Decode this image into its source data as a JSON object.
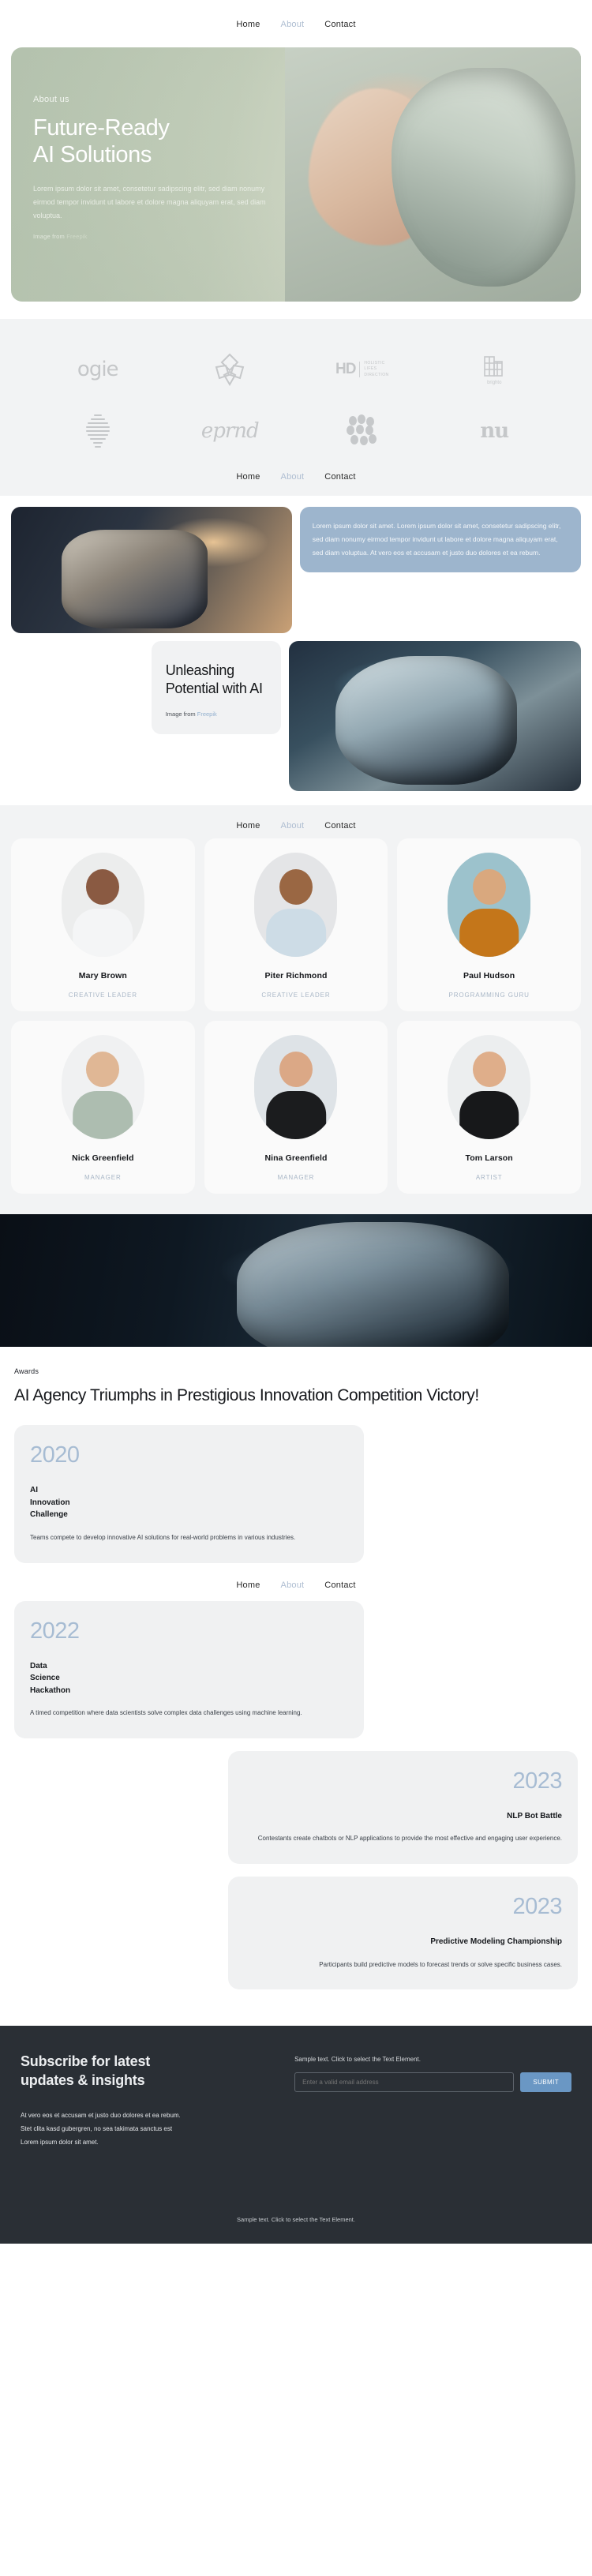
{
  "nav": {
    "items": [
      {
        "label": "Home",
        "state": "active"
      },
      {
        "label": "About",
        "state": "muted"
      },
      {
        "label": "Contact",
        "state": "default"
      }
    ]
  },
  "hero": {
    "eyebrow": "About us",
    "title_line1": "Future-Ready",
    "title_line2": "AI Solutions",
    "paragraph": "Lorem ipsum dolor sit amet, consetetur sadipscing elitr, sed diam nonumy eirmod tempor invidunt ut labore et dolore magna aliquyam erat, sed diam voluptua.",
    "credit_prefix": "Image from ",
    "credit_link": "Freepik",
    "background_color": "#c2cdb9"
  },
  "logos": {
    "items": [
      {
        "name": "ogie",
        "type": "wordmark"
      },
      {
        "name": "flower-mark",
        "type": "symbol"
      },
      {
        "name": "HD",
        "type": "hd",
        "sub_line1": "HOLISTIC",
        "sub_line2": "LIFES",
        "sub_line3": "DIRECTION"
      },
      {
        "name": "brighto",
        "type": "brighto",
        "caption": "brighto"
      },
      {
        "name": "striped-sphere",
        "type": "symbol"
      },
      {
        "name": "eprnd",
        "type": "wordmark"
      },
      {
        "name": "dots-mark",
        "type": "symbol"
      },
      {
        "name": "nu",
        "type": "wordmark"
      }
    ]
  },
  "showcase": {
    "blue_card_text": "Lorem ipsum dolor sit amet. Lorem ipsum dolor sit amet, consetetur sadipscing elitr, sed diam nonumy eirmod tempor invidunt ut labore et dolore magna aliquyam erat, sed diam voluptua. At vero eos et accusam et justo duo dolores et ea rebum.",
    "blue_card_color": "#9db5cd",
    "card_title_line1": "Unleashing",
    "card_title_line2": "Potential with AI",
    "credit_prefix": "Image from ",
    "credit_link": "Freepik",
    "image_left_name": "robot-workshop-photo",
    "image_right_name": "robot-face-photo"
  },
  "team": {
    "members": [
      {
        "name": "Mary Brown",
        "role": "CREATIVE LEADER",
        "bg": "#eceded",
        "skin": "#8a5a42",
        "cloth": "#f4f5f6",
        "hair": "#1d1a18"
      },
      {
        "name": "Piter Richmond",
        "role": "CREATIVE LEADER",
        "bg": "#e4e5e7",
        "skin": "#9a6743",
        "cloth": "#cddce6",
        "hair": "#4a3322"
      },
      {
        "name": "Paul Hudson",
        "role": "PROGRAMMING GURU",
        "bg": "#9cc2cc",
        "skin": "#d9a87e",
        "cloth": "#c4761a",
        "hair": "#3a2b22"
      },
      {
        "name": "Nick Greenfield",
        "role": "MANAGER",
        "bg": "#f0f1f2",
        "skin": "#e0b795",
        "cloth": "#adbdb0",
        "hair": "#6b5743"
      },
      {
        "name": "Nina Greenfield",
        "role": "MANAGER",
        "bg": "#dee3e7",
        "skin": "#dba886",
        "cloth": "#1b1c1e",
        "hair": "#2a2622"
      },
      {
        "name": "Tom Larson",
        "role": "ARTIST",
        "bg": "#eceeef",
        "skin": "#dfae8a",
        "cloth": "#17181a",
        "hair": "#3c2f26"
      }
    ]
  },
  "banner": {
    "image_name": "robot-head-dark-banner"
  },
  "awards": {
    "eyebrow": "Awards",
    "title": "AI Agency Triumphs in Prestigious Innovation Competition Victory!",
    "year_color": "#a7bcd3",
    "items": [
      {
        "year": "2020",
        "name": "AI\nInnovation\nChallenge",
        "description": "Teams compete to develop innovative AI solutions for real-world problems in various industries.",
        "align": "left"
      },
      {
        "year": "2022",
        "name": "Data\nScience\nHackathon",
        "description": "A timed competition where data scientists solve complex data challenges using machine learning.",
        "align": "left"
      },
      {
        "year": "2023",
        "name": "NLP Bot Battle",
        "description": "Contestants create chatbots or NLP applications to provide the most effective and engaging user experience.",
        "align": "right"
      },
      {
        "year": "2023",
        "name": "Predictive Modeling Championship",
        "description": "Participants build predictive models to forecast trends or solve specific business cases.",
        "align": "right"
      }
    ]
  },
  "footer": {
    "title_line1": "Subscribe for latest",
    "title_line2": "updates & insights",
    "sample_note": "Sample text. Click to select the Text Element.",
    "email_placeholder": "Enter a valid email address",
    "submit_label": "SUBMIT",
    "submit_color": "#6a97c4",
    "copy_line1": "At vero eos et accusam et justo duo dolores et ea rebum.",
    "copy_line2": "Stet clita kasd gubergren, no sea takimata sanctus est",
    "copy_line3": "Lorem ipsum dolor sit amet.",
    "bottom_note": "Sample text. Click to select the Text Element.",
    "background_color": "#2a2f35"
  }
}
